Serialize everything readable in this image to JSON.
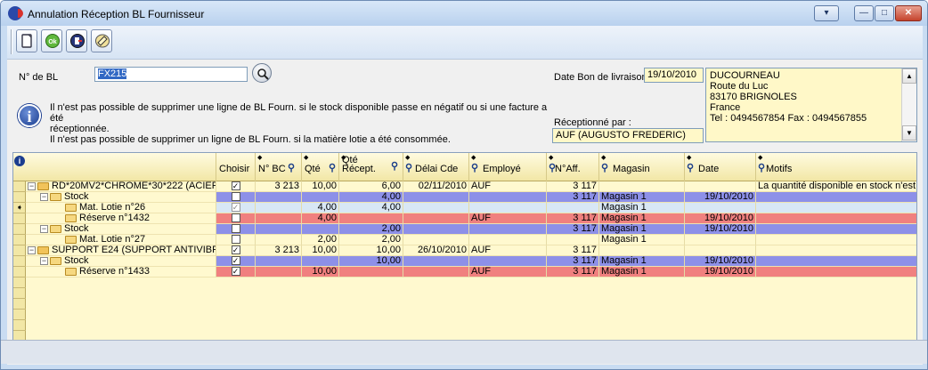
{
  "window": {
    "title": "Annulation Réception BL Fournisseur",
    "controls": [
      "▾",
      "—",
      "□",
      "✕"
    ]
  },
  "toolbar": {
    "buttons": [
      {
        "name": "new-button",
        "icon": "new-document-icon"
      },
      {
        "name": "ok-button",
        "label": "Ok",
        "icon": "ok-icon"
      },
      {
        "name": "exit-button",
        "icon": "exit-door-icon"
      },
      {
        "name": "erase-button",
        "icon": "eraser-icon"
      }
    ]
  },
  "bl": {
    "label": "N° de BL",
    "value": "FX215"
  },
  "info": {
    "line1": "Il n'est pas possible de supprimer une ligne de BL Fourn. si le stock disponible passe en négatif ou si une facture a été",
    "line2": "réceptionnée.",
    "line3": "Il n'est pas possible de supprimer un ligne de BL Fourn. si la matière lotie a été consommée."
  },
  "delivery": {
    "date_label": "Date Bon de livraison :",
    "date_value": "19/10/2010",
    "received_label": "Réceptionné par :",
    "received_value": "AUF  (AUGUSTO FREDERIC)"
  },
  "supplier": {
    "lines": [
      "DUCOURNEAU",
      "Route du Luc",
      "83170 BRIGNOLES",
      "France",
      "Tel : 0494567854 Fax : 0494567855"
    ]
  },
  "grid": {
    "columns": [
      "",
      "Choisir",
      "N° BC",
      "Qté",
      "Qté Récept.",
      "Délai Cde",
      "Employé",
      "N°Aff.",
      "Magasin",
      "Date",
      "Motifs"
    ],
    "rows": [
      {
        "level": 0,
        "exp": "⊟",
        "label": "RD*20MV2*CHROME*30*222 (ACIER",
        "chk": "✓",
        "bc": "3 213",
        "qte": "10,00",
        "qrec": "6,00",
        "delai": "02/11/2010",
        "emp": "AUF",
        "aff": "3 117",
        "mag": "",
        "date": "",
        "motif": "La quantité disponible en stock n'est pa",
        "style": ""
      },
      {
        "level": 1,
        "exp": "⊟",
        "label": "Stock",
        "chk": "",
        "bc": "",
        "qte": "",
        "qrec": "4,00",
        "delai": "",
        "emp": "",
        "aff": "3 117",
        "mag": "Magasin 1",
        "date": "19/10/2010",
        "motif": "",
        "style": "blue"
      },
      {
        "level": 2,
        "exp": "",
        "label": "Mat. Lotie n°26",
        "chk": "✓",
        "bc": "",
        "qte": "4,00",
        "qrec": "4,00",
        "delai": "",
        "emp": "",
        "aff": "",
        "mag": "Magasin 1",
        "date": "",
        "motif": "",
        "style": "light"
      },
      {
        "level": 2,
        "exp": "",
        "label": "Réserve n°1432",
        "chk": "",
        "bc": "",
        "qte": "4,00",
        "qrec": "",
        "delai": "",
        "emp": "AUF",
        "aff": "3 117",
        "mag": "Magasin 1",
        "date": "19/10/2010",
        "motif": "",
        "style": "red"
      },
      {
        "level": 1,
        "exp": "⊟",
        "label": "Stock",
        "chk": "",
        "bc": "",
        "qte": "",
        "qrec": "2,00",
        "delai": "",
        "emp": "",
        "aff": "3 117",
        "mag": "Magasin 1",
        "date": "19/10/2010",
        "motif": "",
        "style": "blue"
      },
      {
        "level": 2,
        "exp": "",
        "label": "Mat. Lotie n°27",
        "chk": "",
        "bc": "",
        "qte": "2,00",
        "qrec": "2,00",
        "delai": "",
        "emp": "",
        "aff": "",
        "mag": "Magasin 1",
        "date": "",
        "motif": "",
        "style": ""
      },
      {
        "level": 0,
        "exp": "⊟",
        "label": "SUPPORT E24 (SUPPORT ANTIVIBF",
        "chk": "✓",
        "bc": "3 213",
        "qte": "10,00",
        "qrec": "10,00",
        "delai": "26/10/2010",
        "emp": "AUF",
        "aff": "3 117",
        "mag": "",
        "date": "",
        "motif": "",
        "style": ""
      },
      {
        "level": 1,
        "exp": "⊟",
        "label": "Stock",
        "chk": "✓",
        "bc": "",
        "qte": "",
        "qrec": "10,00",
        "delai": "",
        "emp": "",
        "aff": "3 117",
        "mag": "Magasin 1",
        "date": "19/10/2010",
        "motif": "",
        "style": "blue"
      },
      {
        "level": 2,
        "exp": "",
        "label": "Réserve n°1433",
        "chk": "✓",
        "bc": "",
        "qte": "10,00",
        "qrec": "",
        "delai": "",
        "emp": "AUF",
        "aff": "3 117",
        "mag": "Magasin 1",
        "date": "19/10/2010",
        "motif": "",
        "style": "red"
      }
    ]
  },
  "colors": {
    "row_blue": "#8d90e8",
    "row_red": "#f0807f",
    "row_light": "#d8e7f5",
    "grid_bg": "#fff9cf"
  }
}
